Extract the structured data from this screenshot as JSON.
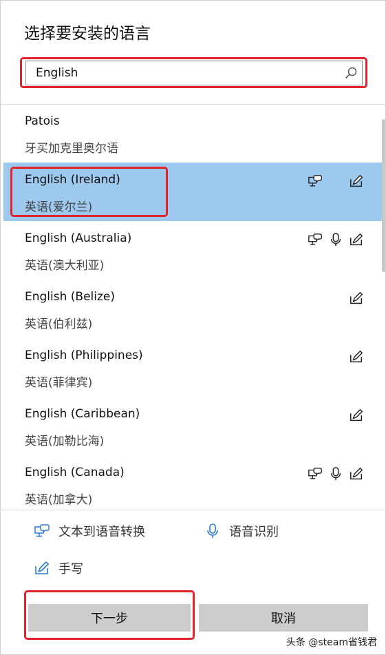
{
  "dialog": {
    "title": "选择要安装的语言"
  },
  "search": {
    "value": "English"
  },
  "languages": [
    {
      "name": "Patois",
      "native": "牙买加克里奥尔语",
      "features": []
    },
    {
      "name": "English (Ireland)",
      "native": "英语(爱尔兰)",
      "features": [
        "tts",
        "handwriting"
      ],
      "selected": true
    },
    {
      "name": "English (Australia)",
      "native": "英语(澳大利亚)",
      "features": [
        "tts",
        "speech",
        "handwriting"
      ]
    },
    {
      "name": "English (Belize)",
      "native": "英语(伯利兹)",
      "features": [
        "handwriting"
      ]
    },
    {
      "name": "English (Philippines)",
      "native": "英语(菲律宾)",
      "features": [
        "handwriting"
      ]
    },
    {
      "name": "English (Caribbean)",
      "native": "英语(加勒比海)",
      "features": [
        "handwriting"
      ]
    },
    {
      "name": "English (Canada)",
      "native": "英语(加拿大)",
      "features": [
        "tts",
        "speech",
        "handwriting"
      ]
    }
  ],
  "legend": {
    "tts_label": "文本到语音转换",
    "speech_label": "语音识别",
    "handwriting_label": "手写"
  },
  "buttons": {
    "next_label": "下一步",
    "cancel_label": "取消"
  },
  "watermark": "头条 @steam省钱君",
  "colors": {
    "selected_row": "#9dc9ef",
    "icon_blue": "#2b7bd1",
    "annotation_red": "#e0242a",
    "button_gray": "#cccccc"
  },
  "icons": {
    "tts": "speech-bubble-monitor-icon",
    "speech": "microphone-icon",
    "handwriting": "pen-on-pad-icon",
    "search": "magnifier-icon"
  }
}
